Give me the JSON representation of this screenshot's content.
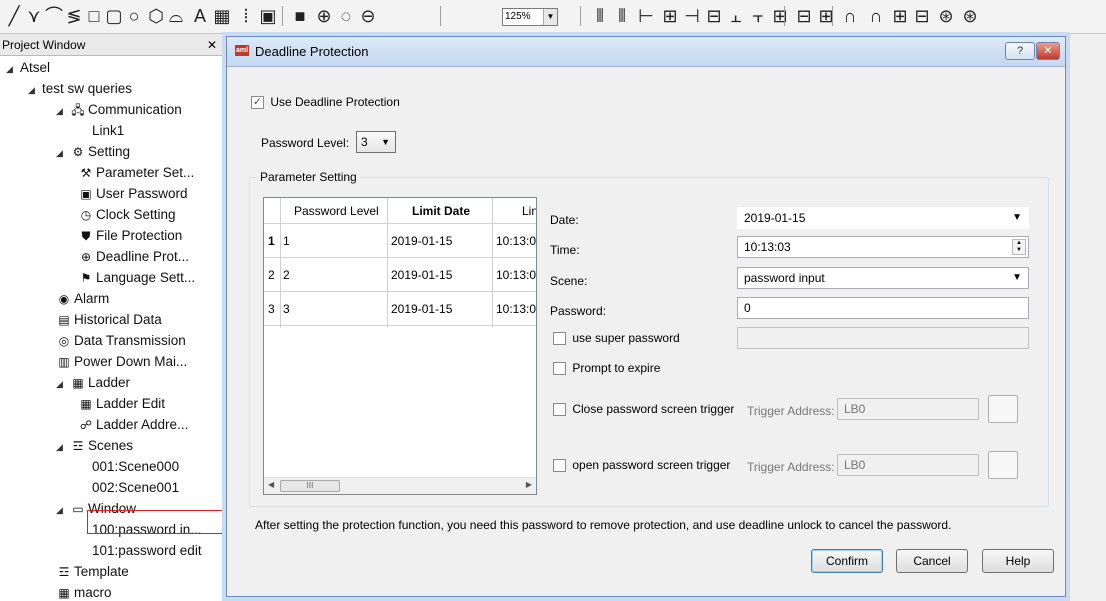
{
  "toolbar": {
    "icons": [
      "polyline-icon",
      "polygon-icon",
      "arc-icon",
      "freeform-icon",
      "rectangle-icon",
      "rounded-rectangle-icon",
      "circle-icon",
      "hexagon-icon",
      "shape-icon",
      "text-icon",
      "table-icon",
      "scale-icon",
      "picture-icon",
      "fill-icon",
      "zoom-in-icon",
      "zoom-reset-icon",
      "zoom-out-icon",
      "align-top-icon",
      "align-bottom-icon",
      "align-left-icon",
      "align-center-icon",
      "align-right-icon",
      "align-middle-icon",
      "distribute-h-icon",
      "distribute-v-icon",
      "group-icon",
      "ungroup-icon",
      "grid-icon",
      "rotate-left-icon",
      "rotate-right-icon",
      "mirror-icon",
      "layer-icon",
      "copy-icon",
      "paste-icon"
    ],
    "zoom_value": "125%"
  },
  "project_window": {
    "title": "Project Window",
    "close_label": "✕",
    "tree": [
      {
        "label": "Atsel",
        "level": 0,
        "expand": "◢",
        "icon": ""
      },
      {
        "label": "test sw queries",
        "level": 1,
        "expand": "◢",
        "icon": ""
      },
      {
        "label": "Communication",
        "level": 2,
        "expand": "◢",
        "icon": "🖧"
      },
      {
        "label": "Link1",
        "level": 3,
        "expand": "",
        "icon": ""
      },
      {
        "label": "Setting",
        "level": 2,
        "expand": "◢",
        "icon": "⚙"
      },
      {
        "label": "Parameter Set...",
        "level": 3,
        "expand": "",
        "icon": "⚒"
      },
      {
        "label": "User Password",
        "level": 3,
        "expand": "",
        "icon": "▣"
      },
      {
        "label": "Clock Setting",
        "level": 3,
        "expand": "",
        "icon": "◷"
      },
      {
        "label": "File Protection",
        "level": 3,
        "expand": "",
        "icon": "⛊"
      },
      {
        "label": "Deadline Prot...",
        "level": 3,
        "expand": "",
        "icon": "⊕"
      },
      {
        "label": "Language Sett...",
        "level": 3,
        "expand": "",
        "icon": "⚑"
      },
      {
        "label": "Alarm",
        "level": 2,
        "expand": "",
        "icon": "◉"
      },
      {
        "label": "Historical Data",
        "level": 2,
        "expand": "",
        "icon": "▤"
      },
      {
        "label": "Data Transmission",
        "level": 2,
        "expand": "",
        "icon": "◎"
      },
      {
        "label": "Power Down Mai...",
        "level": 2,
        "expand": "",
        "icon": "▥"
      },
      {
        "label": "Ladder",
        "level": 2,
        "expand": "◢",
        "icon": "▦"
      },
      {
        "label": "Ladder Edit",
        "level": 3,
        "expand": "",
        "icon": "▦"
      },
      {
        "label": "Ladder Addre...",
        "level": 3,
        "expand": "",
        "icon": "☍"
      },
      {
        "label": "Scenes",
        "level": 2,
        "expand": "◢",
        "icon": "☲"
      },
      {
        "label": "001:Scene000",
        "level": 3,
        "expand": "",
        "icon": ""
      },
      {
        "label": "002:Scene001",
        "level": 3,
        "expand": "",
        "icon": ""
      },
      {
        "label": "Window",
        "level": 2,
        "expand": "◢",
        "icon": "▭"
      },
      {
        "label": "100:password in...",
        "level": 3,
        "expand": "",
        "icon": ""
      },
      {
        "label": "101:password  edit",
        "level": 3,
        "expand": "",
        "icon": ""
      },
      {
        "label": "Template",
        "level": 2,
        "expand": "",
        "icon": "☲"
      },
      {
        "label": "macro",
        "level": 2,
        "expand": "",
        "icon": "▦"
      }
    ]
  },
  "dialog": {
    "title": "Deadline Protection",
    "app_icon_text": "aml",
    "help_button": "?",
    "close_button": "✕",
    "use_deadline_label": "Use Deadline Protection",
    "use_deadline_checked": true,
    "password_level_label": "Password Level:",
    "password_level_value": "3",
    "parameter_group_label": "Parameter Setting",
    "grid": {
      "columns": [
        "Password Level",
        "Limit Date",
        "Lin"
      ],
      "rows": [
        {
          "num": "1",
          "level": "1",
          "date": "2019-01-15",
          "time": "10:13:0"
        },
        {
          "num": "2",
          "level": "2",
          "date": "2019-01-15",
          "time": "10:13:0"
        },
        {
          "num": "3",
          "level": "3",
          "date": "2019-01-15",
          "time": "10:13:0"
        }
      ]
    },
    "date_label": "Date:",
    "date_value": "2019-01-15",
    "time_label": "Time:",
    "time_value": "10:13:03",
    "scene_label": "Scene:",
    "scene_value": "password input",
    "password_label": "Password:",
    "password_value": "0",
    "super_password_label": "use super password",
    "prompt_expire_label": "Prompt to expire",
    "close_trigger_label": "Close password screen trigger",
    "open_trigger_label": "open password screen trigger",
    "trigger_address_label": "Trigger Address:",
    "trigger_address_close": "LB0",
    "trigger_address_open": "LB0",
    "info_text": "After setting the protection function, you need this password to remove protection, and use deadline unlock to cancel the password.",
    "confirm_label": "Confirm",
    "cancel_label": "Cancel",
    "help_label": "Help"
  }
}
